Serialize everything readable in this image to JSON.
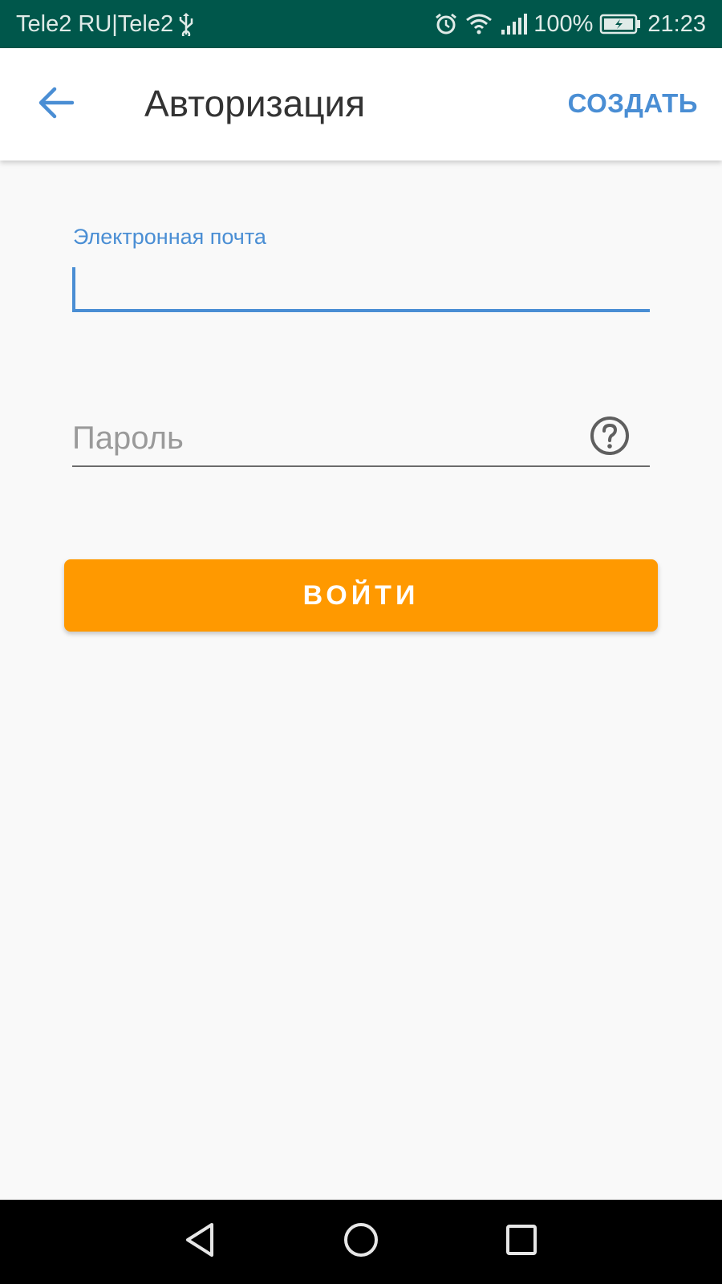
{
  "status_bar": {
    "carrier": "Tele2 RU|Tele2",
    "battery": "100%",
    "time": "21:23",
    "icons": [
      "usb-icon",
      "alarm-icon",
      "wifi-icon",
      "signal-icon",
      "battery-icon"
    ]
  },
  "app_bar": {
    "back_icon": "arrow-left-icon",
    "title": "Авторизация",
    "create_label": "СОЗДАТЬ"
  },
  "form": {
    "email_label": "Электронная почта",
    "email_value": "",
    "password_placeholder": "Пароль",
    "help_icon": "question-circle-icon",
    "login_label": "ВОЙТИ"
  },
  "nav_bar": {
    "icons": [
      "back-triangle-icon",
      "home-circle-icon",
      "recents-square-icon"
    ]
  },
  "colors": {
    "status_bar": "#00574b",
    "accent": "#4a8ed4",
    "button": "#ff9900",
    "background": "#f9f9f9"
  }
}
